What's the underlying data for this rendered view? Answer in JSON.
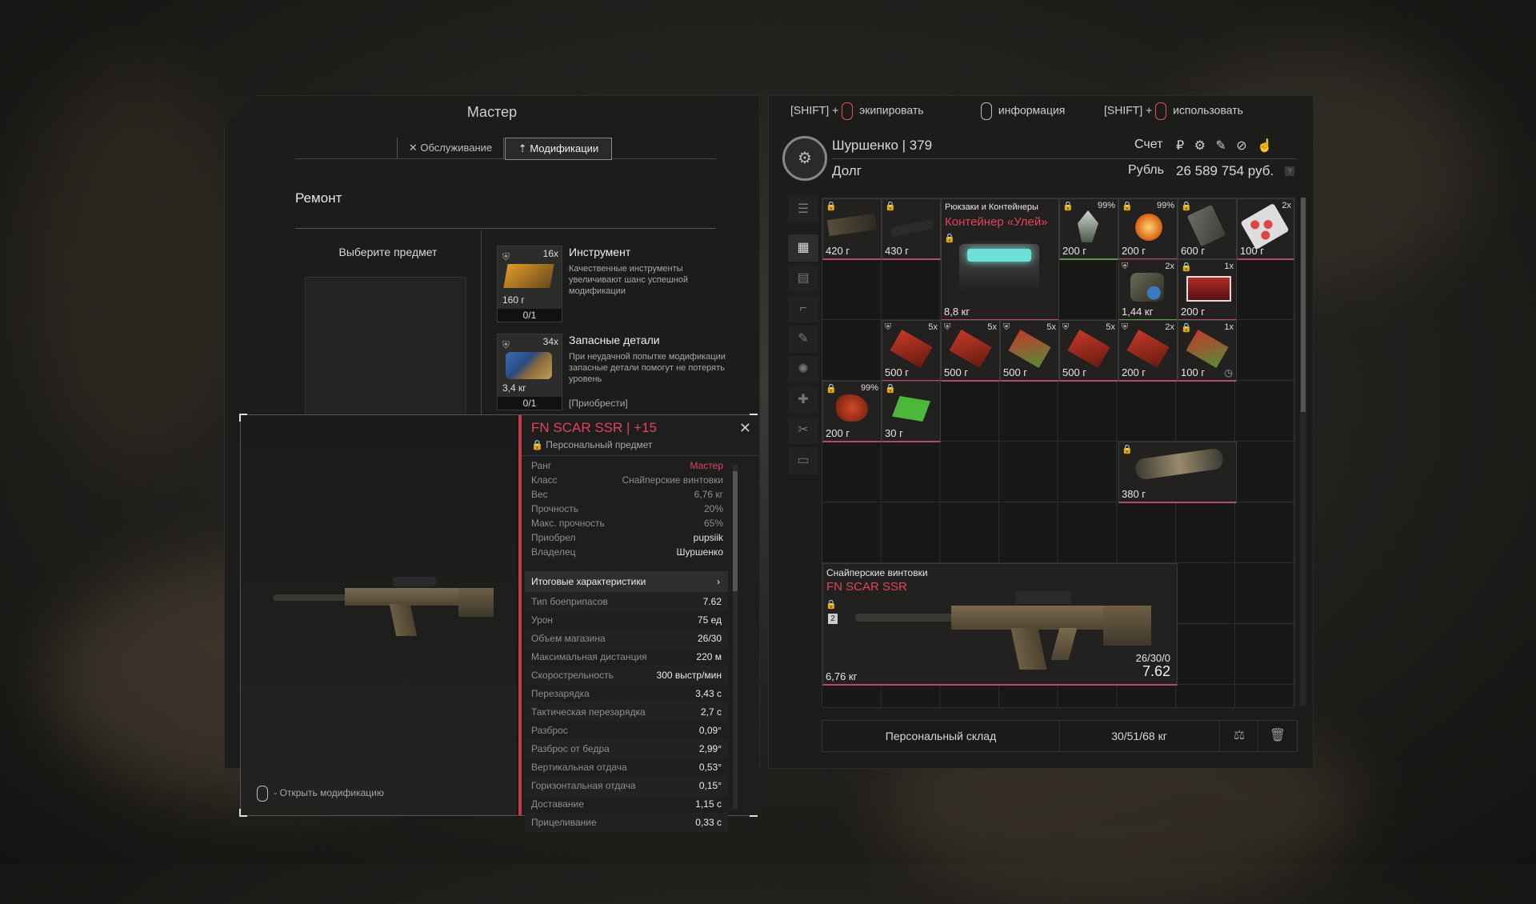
{
  "master": {
    "title": "Мастер",
    "tabs": [
      {
        "icon": "✕",
        "label": "Обслуживание"
      },
      {
        "icon": "⇡",
        "label": "Модификации"
      }
    ],
    "section": "Ремонт",
    "choose_item": "Выберите предмет",
    "materials": [
      {
        "name": "Инструмент",
        "desc": "Качественные инструменты увеличивают шанс успешной модификации",
        "count": "16x",
        "weight": "160 г",
        "fill": "0/1",
        "buy": ""
      },
      {
        "name": "Запасные детали",
        "desc": "При неудачной попытке модификации запасные детали помогут не потерять уровень",
        "count": "34x",
        "weight": "3,4 кг",
        "fill": "0/1",
        "buy": "[Приобрести]"
      }
    ],
    "mouse_hint": "- Открыть модификацию"
  },
  "popup": {
    "title": "FN SCAR SSR | +15",
    "subtitle": "Персональный предмет",
    "attrs": [
      {
        "label": "Ранг",
        "value": "Мастер",
        "style": "hl"
      },
      {
        "label": "Класс",
        "value": "Снайперские винтовки",
        "style": ""
      },
      {
        "label": "Вес",
        "value": "6,76 кг",
        "style": ""
      },
      {
        "label": "Прочность",
        "value": "20%",
        "style": ""
      },
      {
        "label": "Макс. прочность",
        "value": "65%",
        "style": ""
      },
      {
        "label": "Приобрел",
        "value": "pupsiik",
        "style": "lt"
      },
      {
        "label": "Владелец",
        "value": "Шуршенко",
        "style": "lt"
      }
    ],
    "totals_header": "Итоговые характеристики",
    "stats": [
      {
        "label": "Тип боеприпасов",
        "value": "7.62"
      },
      {
        "label": "Урон",
        "value": "75 ед"
      },
      {
        "label": "Объем магазина",
        "value": "26/30"
      },
      {
        "label": "Максимальная дистанция",
        "value": "220 м"
      },
      {
        "label": "Скорострельность",
        "value": "300 выстр/мин"
      },
      {
        "label": "Перезарядка",
        "value": "3,43 с"
      },
      {
        "label": "Тактическая перезарядка",
        "value": "2,7 с"
      },
      {
        "label": "Разброс",
        "value": "0,09°"
      },
      {
        "label": "Разброс от бедра",
        "value": "2,99°"
      },
      {
        "label": "Вертикальная отдача",
        "value": "0,53°"
      },
      {
        "label": "Горизонтальная отдача",
        "value": "0,15°"
      },
      {
        "label": "Доставание",
        "value": "1,15 с"
      },
      {
        "label": "Прицеливание",
        "value": "0,33 с"
      }
    ]
  },
  "hotkeys": [
    {
      "prefix": "[SHIFT] +",
      "label": "экипировать"
    },
    {
      "prefix": "",
      "label": "информация"
    },
    {
      "prefix": "[SHIFT] +",
      "label": "использовать"
    }
  ],
  "trader": {
    "name": "Шуршенко | 379",
    "faction": "Долг",
    "account_label": "Счет",
    "currency_label": "Рубль",
    "balance": "26 589 754 руб.",
    "currency_icons": "₽ ⚙ ✎ ⊘ ☝"
  },
  "items": {
    "row1": [
      {
        "weight": "420 г",
        "tl": "🔒",
        "tr": ""
      },
      {
        "weight": "430 г",
        "tl": "🔒",
        "tr": ""
      },
      {
        "weight": "200 г",
        "tl": "🔒",
        "tr": "99%"
      },
      {
        "weight": "200 г",
        "tl": "🔒",
        "tr": "99%"
      },
      {
        "weight": "600 г",
        "tl": "🔒",
        "tr": ""
      },
      {
        "weight": "100 г",
        "tl": "",
        "tr": "2x"
      }
    ],
    "container": {
      "category": "Рюкзаки и Контейнеры",
      "name": "Контейнер «Улей»",
      "weight": "8,8 кг"
    },
    "row2": [
      {
        "weight": "1,44 кг",
        "tr": "2x"
      },
      {
        "weight": "200 г",
        "tr": "1x"
      }
    ],
    "row3": [
      {
        "weight": "500 г",
        "tr": "5x"
      },
      {
        "weight": "500 г",
        "tr": "5x"
      },
      {
        "weight": "500 г",
        "tr": "5x"
      },
      {
        "weight": "500 г",
        "tr": "5x"
      },
      {
        "weight": "200 г",
        "tr": "2x"
      },
      {
        "weight": "100 г",
        "tr": "1x"
      }
    ],
    "row4": [
      {
        "weight": "200 г",
        "tr": "99%"
      },
      {
        "weight": "30 г",
        "tr": ""
      }
    ],
    "scope": {
      "weight": "380 г"
    },
    "rifle": {
      "category": "Снайперские винтовки",
      "name": "FN SCAR SSR",
      "weight": "6,76 кг",
      "ammo": "26/30/0",
      "caliber": "7.62",
      "tier": "2"
    }
  },
  "footer": {
    "stash_name": "Персональный склад",
    "weight": "30/51/68 кг"
  },
  "colors": {
    "accent": "#e0455a",
    "panel": "#1c1c1b",
    "rarity_red": "#b24a68",
    "rarity_green": "#5a9a48"
  }
}
